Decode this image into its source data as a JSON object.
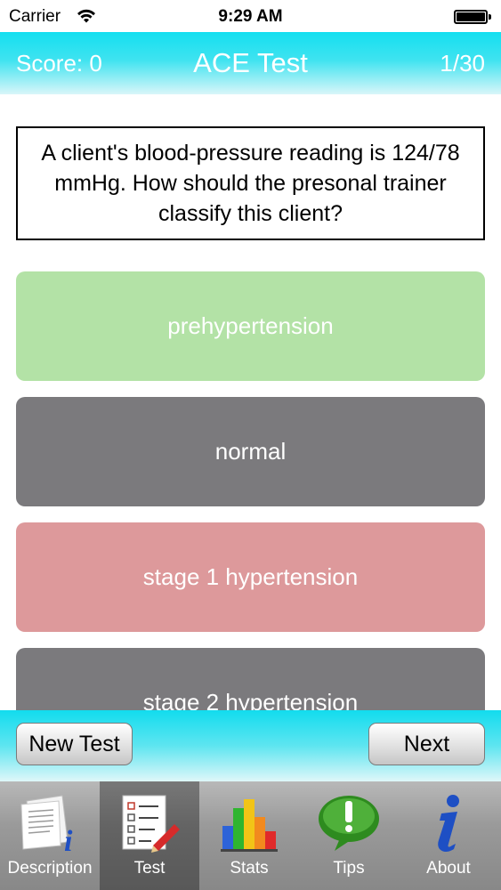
{
  "status_bar": {
    "carrier": "Carrier",
    "time": "9:29 AM"
  },
  "header": {
    "score": "Score: 0",
    "title": "ACE Test",
    "progress": "1/30"
  },
  "question": {
    "text": "A client's blood-pressure reading is 124/78 mmHg. How should the presonal trainer classify this client?"
  },
  "answers": [
    {
      "label": "prehypertension",
      "state": "correct"
    },
    {
      "label": "normal",
      "state": "neutral"
    },
    {
      "label": "stage 1 hypertension",
      "state": "wrong"
    },
    {
      "label": "stage 2 hypertension",
      "state": "neutral"
    }
  ],
  "actions": {
    "new_test": "New Test",
    "next": "Next"
  },
  "tabs": [
    {
      "label": "Description",
      "icon": "document-info-icon"
    },
    {
      "label": "Test",
      "icon": "checklist-icon",
      "active": true
    },
    {
      "label": "Stats",
      "icon": "bar-chart-icon"
    },
    {
      "label": "Tips",
      "icon": "speech-bubble-exclamation-icon"
    },
    {
      "label": "About",
      "icon": "info-icon"
    }
  ],
  "colors": {
    "header": "#14dff0",
    "correct": "#b3e2a6",
    "neutral": "#7b7a7d",
    "wrong": "#dd999b"
  }
}
